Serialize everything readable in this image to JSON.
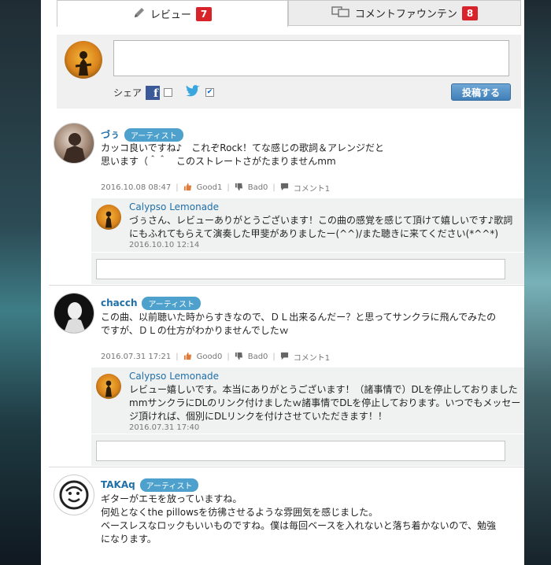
{
  "tabs": [
    {
      "label": "レビュー",
      "count": "7"
    },
    {
      "label": "コメントファウンテン",
      "count": "8"
    }
  ],
  "compose": {
    "share_label": "シェア",
    "facebook_checked": false,
    "twitter_checked": true,
    "post_button": "投稿する"
  },
  "artist_badge": "アーティスト",
  "reviews": [
    {
      "user": "づぅ",
      "lines": [
        "カッコ良いですね♪　これぞRock！てな感じの歌詞＆アレンジだと",
        "思います（＾＾　このストレートさがたまりませんmm"
      ],
      "date": "2016.10.08 08:47",
      "good": "Good1",
      "bad": "Bad0",
      "comment": "コメント1",
      "reply": {
        "user": "Calypso Lemonade",
        "lines": [
          "づぅさん、レビューありがとうございます！この曲の感覚を感じて頂けて嬉しいです♪歌詞",
          "にもふれてもらえて演奏した甲斐がありましたー(^^)/また聴きに来てください(*^^*)"
        ],
        "date": "2016.10.10 12:14"
      }
    },
    {
      "user": "chacch",
      "lines": [
        "この曲、以前聴いた時からすきなので、ＤＬ出来るんだー？と思ってサンクラに飛んでみたの",
        "ですが、ＤＬの仕方がわかりませんでしたｗ"
      ],
      "date": "2016.07.31 17:21",
      "good": "Good0",
      "bad": "Bad0",
      "comment": "コメント1",
      "reply": {
        "user": "Calypso Lemonade",
        "lines": [
          "レビュー嬉しいです。本当にありがとうございます！（諸事情で）DLを停止しておりました",
          "mmサンクラにDLのリンク付けましたｗ諸事情でDLを停止しております。いつでもメッセー",
          "ジ頂ければ、個別にDLリンクを付けさせていただきます！！"
        ],
        "date": "2016.07.31 17:40"
      }
    },
    {
      "user": "TAKAq",
      "lines": [
        "ギターがエモを放っていますね。",
        "何処となくthe pillowsを彷彿させるような雰囲気を感じました。",
        "ベースレスなロックもいいものですね。僕は毎回ベースを入れないと落ち着かないので、勉強",
        "になります。"
      ]
    }
  ]
}
